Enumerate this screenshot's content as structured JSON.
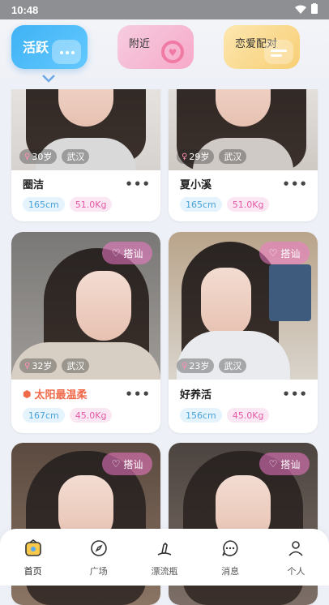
{
  "status": {
    "time": "10:48"
  },
  "tabs": {
    "active": "活跃",
    "nearby": "附近",
    "match": "恋爱配对"
  },
  "cards": [
    {
      "name": "圈洁",
      "age": "30岁",
      "city": "武汉",
      "height": "165cm",
      "weight": "51.0Kg",
      "chat": ""
    },
    {
      "name": "夏小溪",
      "age": "29岁",
      "city": "武汉",
      "height": "165cm",
      "weight": "51.0Kg",
      "chat": ""
    },
    {
      "name": "太阳最温柔",
      "age": "32岁",
      "city": "武汉",
      "height": "167cm",
      "weight": "45.0Kg",
      "chat": "搭讪",
      "vip": true
    },
    {
      "name": "好养活",
      "age": "23岁",
      "city": "武汉",
      "height": "156cm",
      "weight": "45.0Kg",
      "chat": "搭讪"
    },
    {
      "name": "",
      "age": "",
      "city": "",
      "height": "",
      "weight": "",
      "chat": "搭讪"
    },
    {
      "name": "",
      "age": "",
      "city": "",
      "height": "",
      "weight": "",
      "chat": "搭讪"
    }
  ],
  "nav": [
    {
      "label": "首页",
      "icon": "home-icon",
      "active": true
    },
    {
      "label": "广场",
      "icon": "compass-icon"
    },
    {
      "label": "漂流瓶",
      "icon": "bottle-icon"
    },
    {
      "label": "消息",
      "icon": "message-icon"
    },
    {
      "label": "个人",
      "icon": "person-icon"
    }
  ],
  "colors": {
    "accent": "#3fb2f4",
    "pink": "#e35aa4",
    "chat_btn": "#f078c8"
  }
}
